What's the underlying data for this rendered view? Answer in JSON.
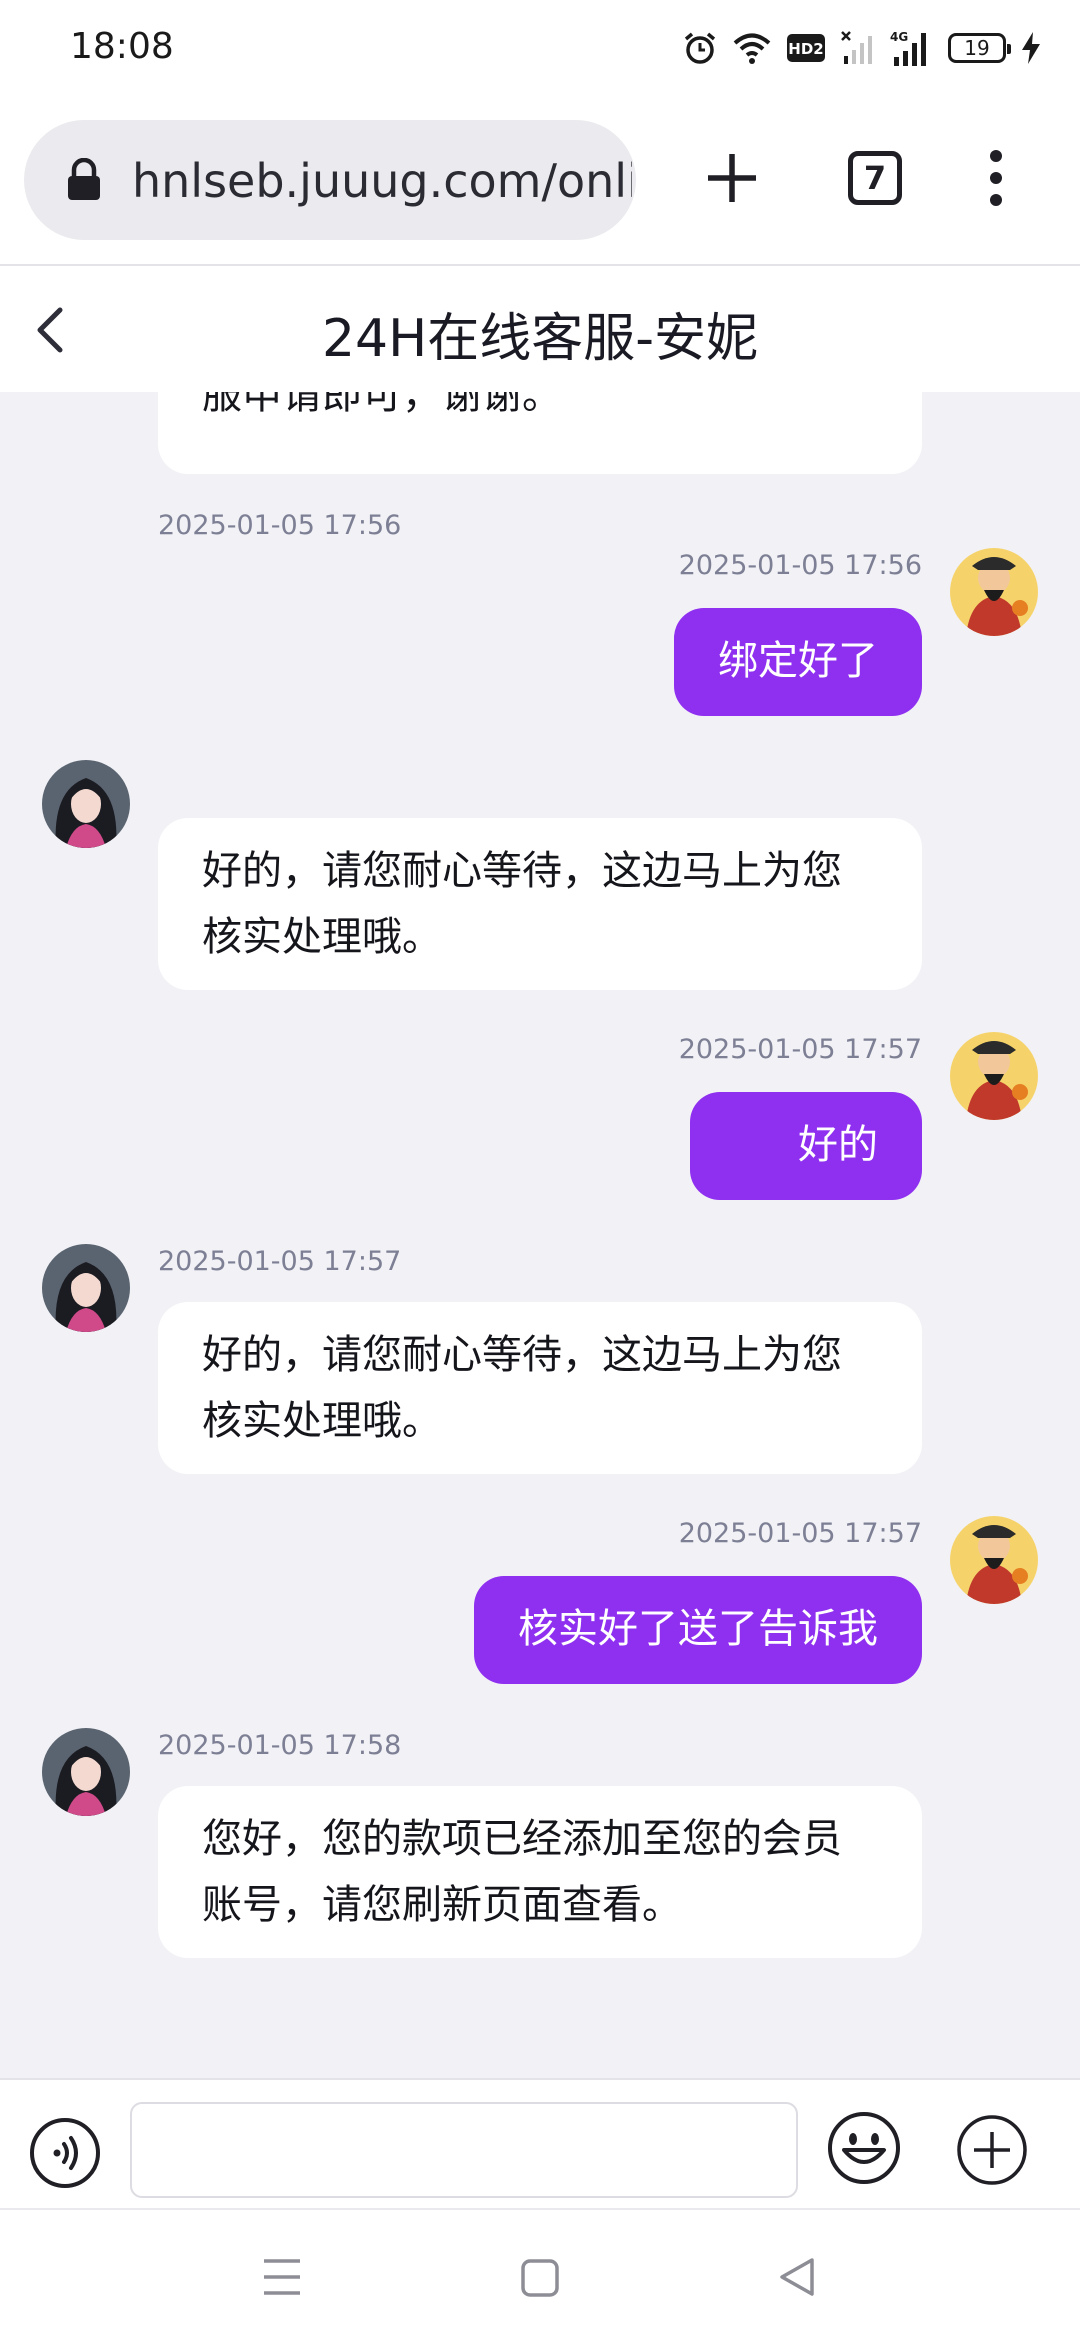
{
  "status_bar": {
    "time": "18:08",
    "battery": "19",
    "icons": [
      "alarm-icon",
      "wifi-icon",
      "hd-icon",
      "signal-1-icon",
      "signal-4g-icon",
      "battery-icon",
      "charging-icon"
    ],
    "hd_label": "HD2",
    "network_label": "4G"
  },
  "browser": {
    "url": "hnlseb.juuug.com/online",
    "tab_count": "7"
  },
  "header": {
    "title": "24H在线客服-安妮"
  },
  "messages": [
    {
      "sender": "agent",
      "text": "银行卡信息，绑定成功后联系在线客服申请即可，谢谢。",
      "partial_visible_text": "服申请即可，谢谢。"
    },
    {
      "sender": "user",
      "time": "2025-01-05 17:56",
      "text": "绑定好了"
    },
    {
      "sender": "agent",
      "time": "2025-01-05 17:56",
      "text_line1": "好的，请您耐心等待，这边马上为您",
      "text_line2": "核实处理哦。"
    },
    {
      "sender": "user",
      "time": "2025-01-05 17:57",
      "text": "好的"
    },
    {
      "sender": "agent",
      "time": "2025-01-05 17:57",
      "text_line1": "好的，请您耐心等待，这边马上为您",
      "text_line2": "核实处理哦。"
    },
    {
      "sender": "user",
      "time": "2025-01-05 17:57",
      "text": "核实好了送了告诉我"
    },
    {
      "sender": "agent",
      "time": "2025-01-05 17:58",
      "text_line1": "您好，您的款项已经添加至您的会员",
      "text_line2": "账号，请您刷新页面查看。"
    }
  ],
  "input": {
    "value": "",
    "placeholder": ""
  },
  "colors": {
    "accent": "#8f2ff0",
    "background": "#f1f1f6",
    "timestamp": "#7d7f94"
  }
}
